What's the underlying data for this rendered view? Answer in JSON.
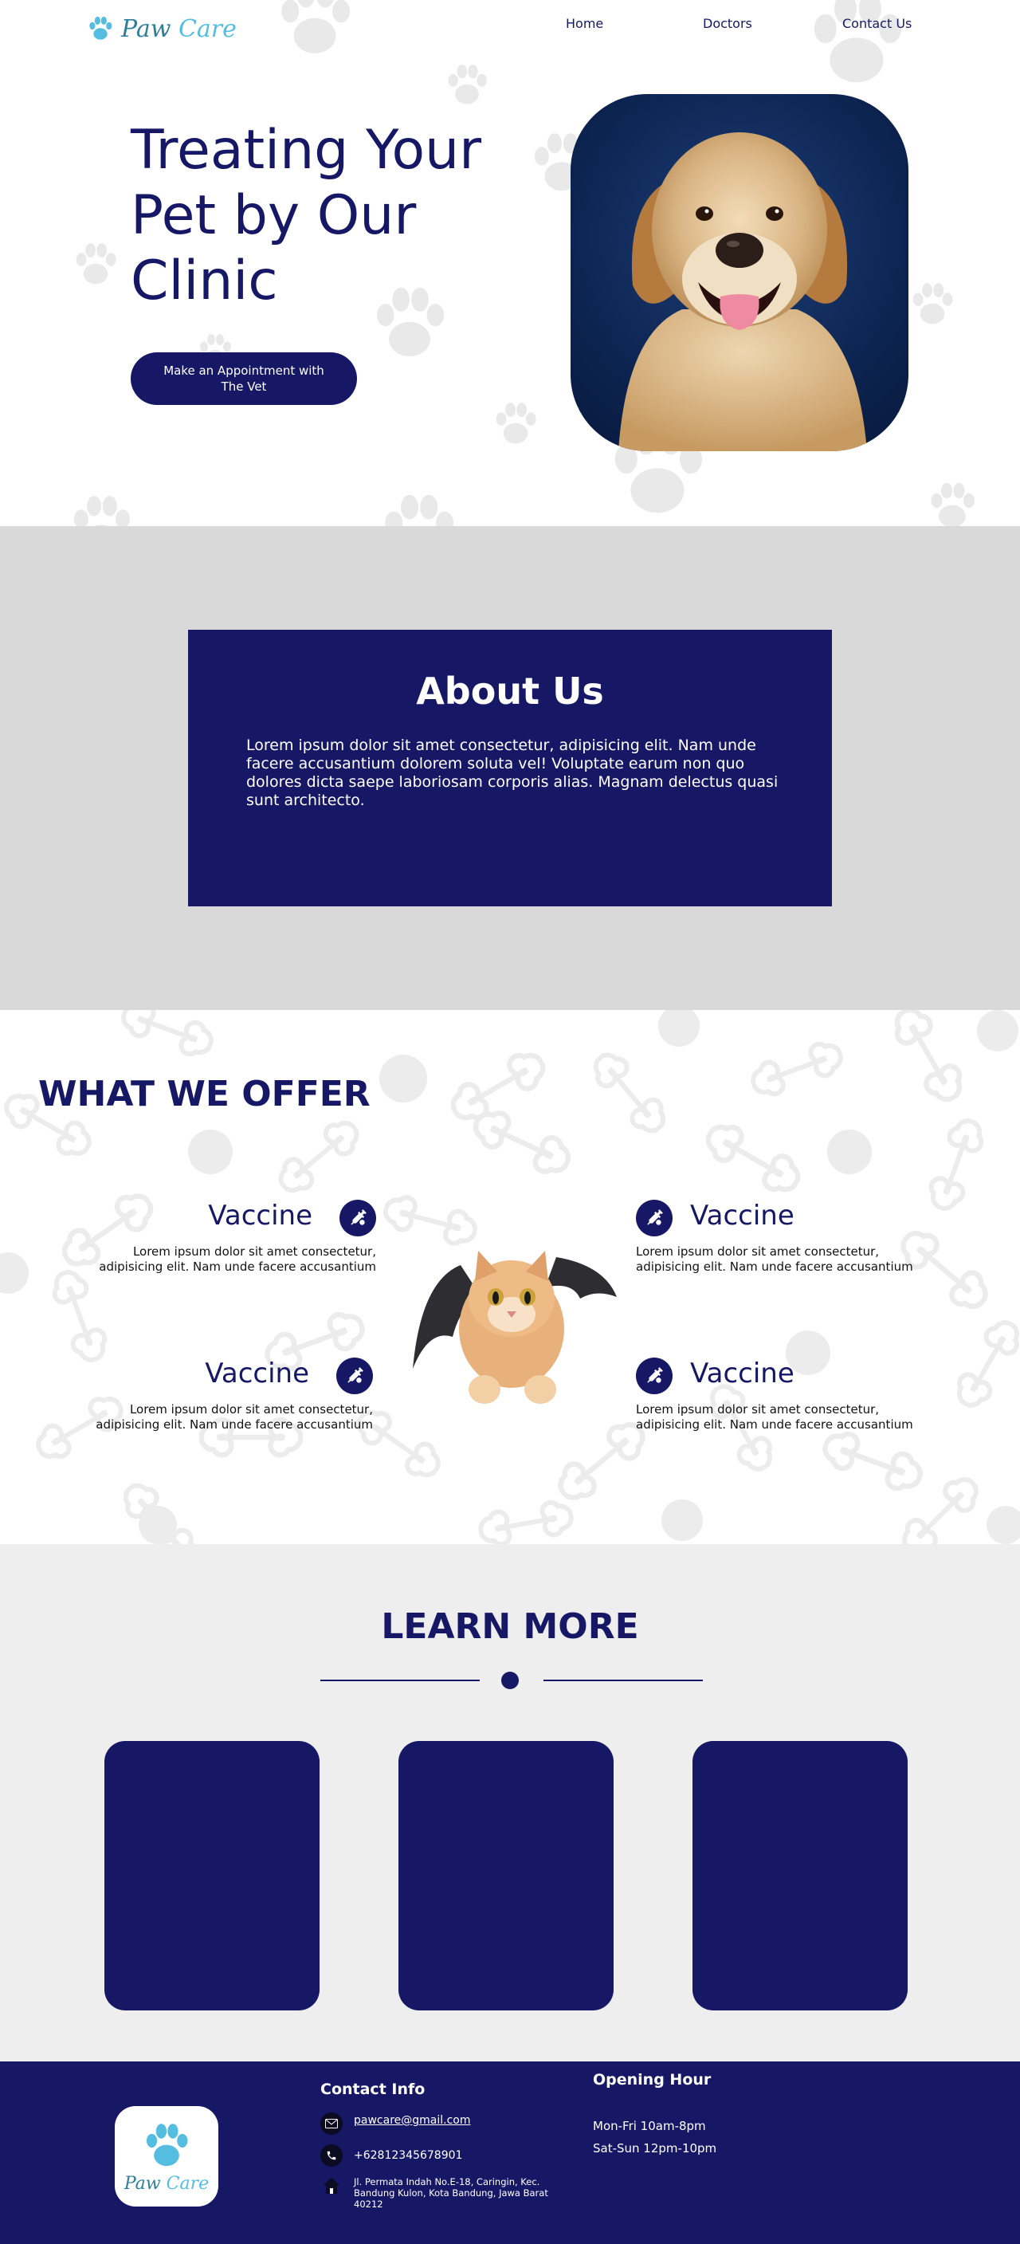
{
  "nav": {
    "brand_paw": "Paw",
    "brand_care": "Care",
    "links": [
      "Home",
      "Doctors",
      "Contact Us"
    ]
  },
  "hero": {
    "title": "Treating Your Pet by Our Clinic",
    "cta": "Make an Appointment with The Vet"
  },
  "about": {
    "title": "About Us",
    "text": "Lorem ipsum dolor sit amet consectetur, adipisicing elit. Nam unde facere accusantium dolorem soluta vel! Voluptate earum non quo dolores dicta saepe laboriosam corporis alias. Magnam delectus quasi sunt architecto."
  },
  "offer": {
    "title": "WHAT WE OFFER",
    "items": [
      {
        "title": "Vaccine",
        "desc": "Lorem ipsum dolor sit amet consectetur, adipisicing elit. Nam unde facere accusantium",
        "icon": "syringe-icon"
      },
      {
        "title": "Vaccine",
        "desc": "Lorem ipsum dolor sit amet consectetur, adipisicing elit. Nam unde facere accusantium",
        "icon": "syringe-icon"
      },
      {
        "title": "Vaccine",
        "desc": "Lorem ipsum dolor sit amet consectetur, adipisicing elit. Nam unde facere accusantium",
        "icon": "syringe-icon"
      },
      {
        "title": "Vaccine",
        "desc": "Lorem ipsum dolor sit amet consectetur, adipisicing elit. Nam unde facere accusantium",
        "icon": "syringe-icon"
      }
    ]
  },
  "learn": {
    "title": "LEARN MORE"
  },
  "footer": {
    "brand_paw": "Paw",
    "brand_care": "Care",
    "contact_title": "Contact Info",
    "email": "pawcare@gmail.com",
    "phone": "+62812345678901",
    "address": "Jl. Permata Indah No.E-18, Caringin, Kec. Bandung Kulon, Kota Bandung, Jawa Barat 40212",
    "hours_title": "Opening Hour",
    "hours": [
      "Mon-Fri 10am-8pm",
      "Sat-Sun 12pm-10pm"
    ]
  },
  "colors": {
    "primary": "#161866",
    "brand_dark": "#2e7e9a",
    "brand_light": "#55bde0",
    "about_bg": "#d9d9d9",
    "learn_bg": "#eeeeee"
  }
}
